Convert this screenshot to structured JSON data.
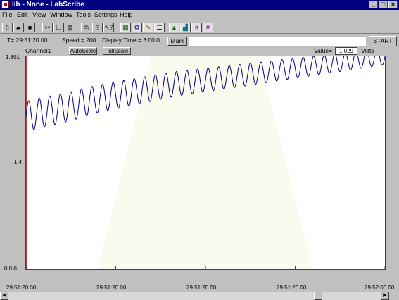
{
  "window": {
    "title": "lib - None - LabScribe",
    "minimize_glyph": "_",
    "maximize_glyph": "□",
    "close_glyph": "×"
  },
  "menu": [
    "File",
    "Edit",
    "View",
    "Window",
    "Tools",
    "Settings",
    "Help"
  ],
  "toolbar": {
    "buttons": [
      {
        "icon": "new-file-icon",
        "glyph": "▯"
      },
      {
        "icon": "open-folder-icon",
        "glyph": "▰"
      },
      {
        "icon": "save-icon",
        "glyph": "■"
      },
      {
        "icon": "cut-icon",
        "glyph": "✂"
      },
      {
        "icon": "copy-icon",
        "glyph": "❐"
      },
      {
        "icon": "paste-icon",
        "glyph": "▤"
      },
      {
        "icon": "print-icon",
        "glyph": "⎙"
      },
      {
        "icon": "help-icon",
        "glyph": "?"
      },
      {
        "icon": "context-help-icon",
        "glyph": "↖?"
      },
      {
        "icon": "chart-view-icon",
        "glyph": "▦"
      },
      {
        "icon": "analysis-icon",
        "glyph": "⚙"
      },
      {
        "icon": "marks-icon",
        "glyph": "✎"
      },
      {
        "icon": "settings-panel-icon",
        "glyph": "☰"
      },
      {
        "icon": "mountain-icon",
        "glyph": "▲"
      },
      {
        "icon": "landscape-icon",
        "glyph": "▟"
      },
      {
        "icon": "grid-cursor-icon",
        "glyph": "#"
      },
      {
        "icon": "cursor-crosshair-icon",
        "glyph": "#"
      }
    ]
  },
  "info": {
    "time": "T=  29:51:20.00",
    "speed": "Speed = 200",
    "display_time": "Display Time = 3:00.0",
    "mark_label": "Mark",
    "mark_input_value": "",
    "start_label": "START"
  },
  "channel": {
    "name": "Channel1",
    "autoscale_label": "AutoScale",
    "fullscale_label": "FullScale",
    "value_label": "Value=",
    "value": "1.029",
    "unit": "Volts"
  },
  "chart_data": {
    "type": "line",
    "y_ticks": [
      "1.801",
      "1.4",
      "0.0.0"
    ],
    "x_ticks": [
      "29:51:20.00",
      "29:51:20.00",
      "29:51:20.00",
      "29:51:20.00",
      "29:52:00.00"
    ],
    "series": [
      {
        "color": "#000080",
        "description_values": "oscillating trace",
        "x": [
          0,
          0.5,
          1.0,
          1.5,
          2.0,
          2.5,
          3.0,
          3.5,
          4.0,
          4.5,
          5.0,
          5.5,
          6.0,
          6.5,
          7.0,
          7.5,
          8.0,
          8.5,
          9.0,
          9.5,
          10.0
        ],
        "y": [
          1.29,
          1.33,
          1.36,
          1.4,
          1.44,
          1.47,
          1.5,
          1.53,
          1.56,
          1.58,
          1.6,
          1.62,
          1.64,
          1.66,
          1.68,
          1.7,
          1.72,
          1.74,
          1.76,
          1.78,
          1.8
        ]
      }
    ],
    "ylim": [
      0.0,
      1.801
    ]
  }
}
